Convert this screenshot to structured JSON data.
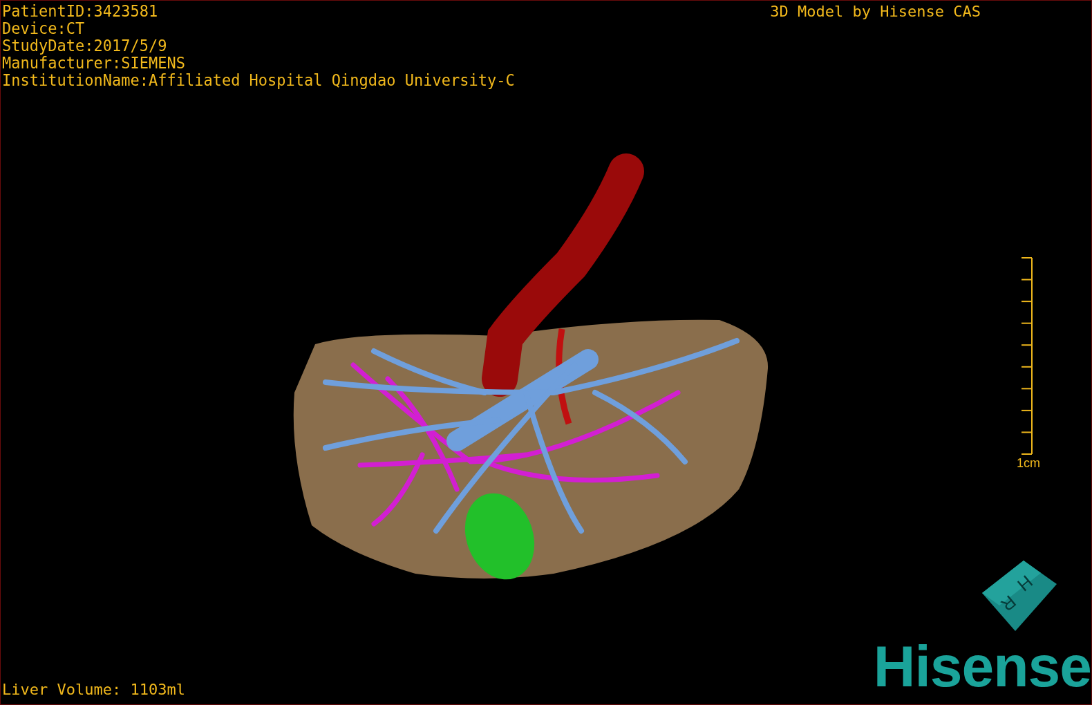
{
  "header": {
    "info_lines": [
      "PatientID:3423581",
      "Device:CT",
      "StudyDate:2017/5/9",
      "Manufacturer:SIEMENS",
      "InstitutionName:Affiliated Hospital Qingdao University-C"
    ],
    "title": "3D Model by Hisense CAS"
  },
  "scale_bar": {
    "label": "1cm"
  },
  "orientation_cube": {
    "faces": [
      "H",
      "R"
    ]
  },
  "footer": {
    "liver_volume": "Liver Volume: 1103ml",
    "logo": "Hisense"
  }
}
